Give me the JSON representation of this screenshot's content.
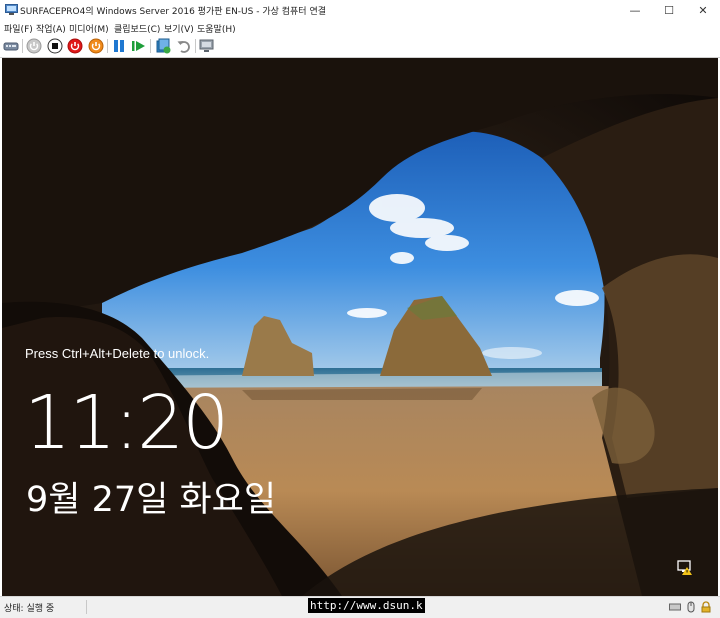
{
  "window": {
    "title": "SURFACEPRO4의 Windows Server 2016 평가판 EN-US - 가상 컴퓨터 연결",
    "controls": {
      "minimize": "—",
      "maximize": "☐",
      "close": "✕"
    }
  },
  "menu": [
    "파일(F)",
    "작업(A)",
    "미디어(M)",
    "클립보드(C)",
    "보기(V)",
    "도움말(H)"
  ],
  "toolbar": [
    {
      "name": "ctrl-alt-del-icon"
    },
    {
      "name": "start-icon"
    },
    {
      "name": "turn-off-icon"
    },
    {
      "name": "shut-down-icon"
    },
    {
      "name": "power-icon"
    },
    {
      "name": "pause-icon"
    },
    {
      "name": "resume-icon"
    },
    {
      "name": "checkpoint-icon"
    },
    {
      "name": "revert-icon"
    },
    {
      "name": "enhanced-session-icon"
    }
  ],
  "lockscreen": {
    "prompt": "Press Ctrl+Alt+Delete to unlock.",
    "time": "11:20",
    "date": "9월 27일 화요일"
  },
  "status": {
    "text": "상태: 실행 중",
    "watermark": "http://www.dsun.k"
  },
  "colors": {
    "sky": "#2a78d2",
    "sand": "#b98a55",
    "cave": "#140e09",
    "power_red": "#e01818",
    "accent_blue": "#1f78d1"
  }
}
